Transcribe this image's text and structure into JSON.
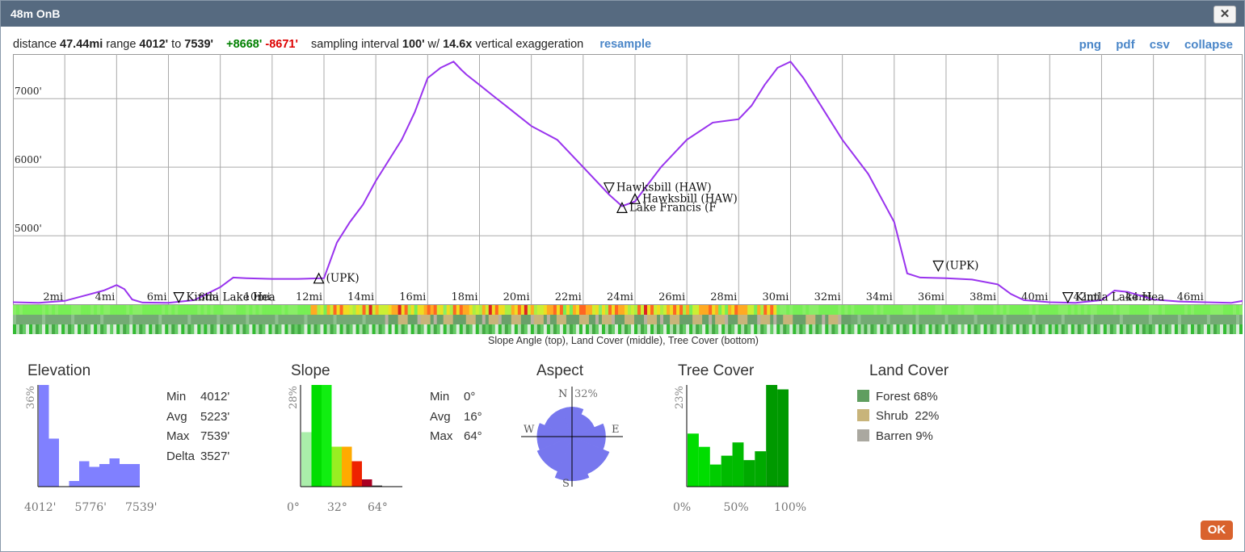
{
  "window": {
    "title": "48m OnB",
    "close_label": "✕"
  },
  "summary": {
    "distance_label": "distance",
    "distance": "47.44mi",
    "range_label": "range",
    "range_min": "4012'",
    "to_label": "to",
    "range_max": "7539'",
    "gain": "+8668'",
    "loss": "-8671'",
    "sampling_label": "sampling interval",
    "sampling": "100'",
    "w_label": "w/",
    "exaggeration": "14.6x",
    "exaggeration_label": "vertical exaggeration",
    "resample": "resample"
  },
  "links": {
    "png": "png",
    "pdf": "pdf",
    "csv": "csv",
    "collapse": "collapse"
  },
  "chart_data": [
    {
      "type": "line",
      "title": "",
      "xlabel": "",
      "ylabel": "",
      "xlim": [
        0,
        47.44
      ],
      "ylim": [
        4000,
        7650
      ],
      "x_tick_labels": [
        "2mi",
        "4mi",
        "6mi",
        "8mi",
        "10mi",
        "12mi",
        "14mi",
        "16mi",
        "18mi",
        "20mi",
        "22mi",
        "24mi",
        "26mi",
        "28mi",
        "30mi",
        "32mi",
        "34mi",
        "36mi",
        "38mi",
        "40mi",
        "42mi",
        "44mi",
        "46mi"
      ],
      "y_tick_labels": [
        "5000'",
        "6000'",
        "7000'"
      ],
      "x": [
        0,
        1,
        2,
        3,
        3.5,
        4,
        4.3,
        4.6,
        5,
        6,
        7,
        8,
        8.5,
        9,
        10,
        11,
        12,
        12.5,
        13,
        13.5,
        14,
        15,
        15.5,
        16,
        16.5,
        17,
        17.3,
        17.5,
        18,
        18.5,
        19,
        20,
        21,
        22,
        23,
        23.5,
        24,
        24.5,
        25,
        26,
        27,
        28,
        28.5,
        29,
        29.5,
        30,
        30.5,
        31,
        32,
        33,
        34,
        34.5,
        35,
        36,
        37,
        38,
        38.5,
        39,
        40,
        41,
        42,
        42.5,
        43,
        44,
        45,
        46,
        47,
        47.44
      ],
      "y": [
        4030,
        4020,
        4050,
        4150,
        4200,
        4280,
        4220,
        4070,
        4025,
        4020,
        4060,
        4250,
        4390,
        4380,
        4370,
        4370,
        4380,
        4900,
        5200,
        5450,
        5800,
        6400,
        6800,
        7300,
        7450,
        7539,
        7420,
        7350,
        7200,
        7050,
        6900,
        6600,
        6400,
        6000,
        5600,
        5430,
        5500,
        5750,
        6000,
        6400,
        6650,
        6700,
        6900,
        7200,
        7450,
        7539,
        7300,
        7000,
        6400,
        5900,
        5200,
        4450,
        4390,
        4380,
        4360,
        4290,
        4150,
        4060,
        4030,
        4020,
        4060,
        4200,
        4180,
        4070,
        4040,
        4030,
        4020,
        4050
      ],
      "waypoints": [
        {
          "x": 6.4,
          "y": 4040,
          "marker": "down",
          "label": "Kintla Lake Hea"
        },
        {
          "x": 11.8,
          "y": 4320,
          "marker": "up",
          "label": "(UPK)"
        },
        {
          "x": 23.0,
          "y": 5640,
          "marker": "down",
          "label": "Hawksbill (HAW)"
        },
        {
          "x": 24.0,
          "y": 5480,
          "marker": "up",
          "label": "Hawksbill (HAW)"
        },
        {
          "x": 23.5,
          "y": 5350,
          "marker": "up",
          "label": "Lake Francis (F"
        },
        {
          "x": 35.7,
          "y": 4500,
          "marker": "down",
          "label": "(UPK)"
        },
        {
          "x": 40.7,
          "y": 4040,
          "marker": "down",
          "label": "Kintla Lake Hea"
        }
      ]
    },
    {
      "type": "bar",
      "title": "Elevation",
      "x_tick_labels": [
        "4012'",
        "5776'",
        "7539'"
      ],
      "y_max_label": "36%",
      "values": [
        36,
        17,
        0,
        2,
        9,
        7,
        8,
        10,
        8,
        8
      ],
      "color": "#8080ff"
    },
    {
      "type": "bar",
      "title": "Slope",
      "x_tick_labels": [
        "0°",
        "32°",
        "64°"
      ],
      "y_max_label": "28%",
      "values": [
        15,
        28,
        28,
        11,
        11,
        7,
        2,
        0.3
      ],
      "colors": [
        "#aaeeaa",
        "#00dd00",
        "#11ee11",
        "#99ee22",
        "#ffaa00",
        "#ee2200",
        "#aa0022",
        "#333333"
      ]
    },
    {
      "type": "rose",
      "title": "Aspect",
      "directions": [
        "N",
        "E",
        "S",
        "W"
      ],
      "max_label": "32%",
      "values": [
        22,
        18,
        25,
        30,
        33,
        28,
        26,
        22
      ],
      "color": "#7777ee"
    },
    {
      "type": "bar",
      "title": "Tree Cover",
      "x_tick_labels": [
        "0%",
        "50%",
        "100%"
      ],
      "y_max_label": "23%",
      "values": [
        12,
        9,
        5,
        7,
        10,
        6,
        8,
        23,
        22
      ],
      "colors": [
        "#00dd00",
        "#00dd00",
        "#00cc00",
        "#00bb00",
        "#00bb00",
        "#00aa00",
        "#00aa00",
        "#009900",
        "#009900"
      ]
    }
  ],
  "strips_caption": "Slope Angle (top), Land Cover (middle), Tree Cover (bottom)",
  "elevation_stats": {
    "min_label": "Min",
    "min": "4012'",
    "avg_label": "Avg",
    "avg": "5223'",
    "max_label": "Max",
    "max": "7539'",
    "delta_label": "Delta",
    "delta": "3527'"
  },
  "slope_stats": {
    "min_label": "Min",
    "min": "0°",
    "avg_label": "Avg",
    "avg": "16°",
    "max_label": "Max",
    "max": "64°"
  },
  "land_cover": {
    "title": "Land Cover",
    "items": [
      {
        "label": "Forest",
        "value": "68%",
        "color": "#5f9e5f"
      },
      {
        "label": "Shrub",
        "value": "22%",
        "color": "#c8b47a"
      },
      {
        "label": "Barren",
        "value": "9%",
        "color": "#aaa8a0"
      }
    ]
  },
  "ok_label": "OK"
}
